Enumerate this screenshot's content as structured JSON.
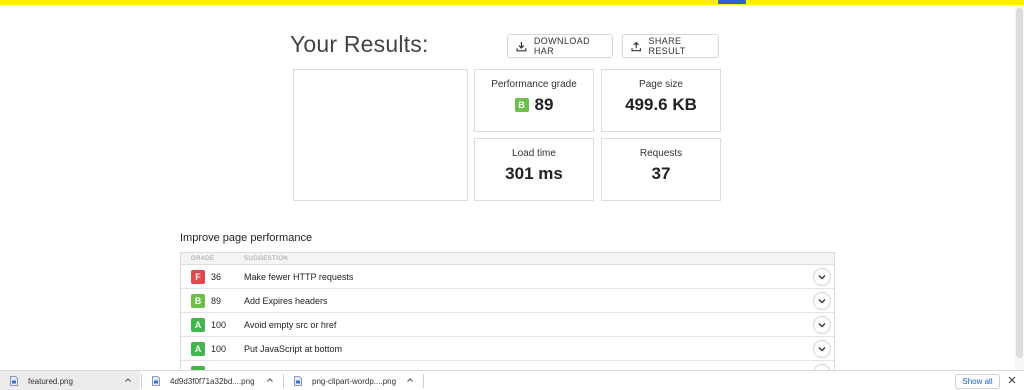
{
  "header": {
    "title": "Your Results:",
    "download_har_label": "DOWNLOAD HAR",
    "share_result_label": "SHARE RESULT"
  },
  "metrics": {
    "performance": {
      "label": "Performance grade",
      "grade": "B",
      "value": "89"
    },
    "page_size": {
      "label": "Page size",
      "value": "499.6 KB"
    },
    "load_time": {
      "label": "Load time",
      "value": "301 ms"
    },
    "requests": {
      "label": "Requests",
      "value": "37"
    }
  },
  "improve": {
    "title": "Improve page performance",
    "columns": {
      "grade": "GRADE",
      "suggestion": "SUGGESTION"
    },
    "rows": [
      {
        "grade": "F",
        "score": "36",
        "suggestion": "Make fewer HTTP requests"
      },
      {
        "grade": "B",
        "score": "89",
        "suggestion": "Add Expires headers"
      },
      {
        "grade": "A",
        "score": "100",
        "suggestion": "Avoid empty src or href"
      },
      {
        "grade": "A",
        "score": "100",
        "suggestion": "Put JavaScript at bottom"
      }
    ]
  },
  "downloads": {
    "items": [
      {
        "name": "featured.png"
      },
      {
        "name": "4d9d3f0f71a32bd....png"
      },
      {
        "name": "png-clipart-wordp....png"
      }
    ],
    "show_all_label": "Show all"
  },
  "colors": {
    "top_bar": "#ffee00",
    "grade_a": "#43b649",
    "grade_b": "#6cc04a",
    "grade_f": "#e5454c",
    "link_blue": "#1a5fd6"
  },
  "icons": [
    "download-icon",
    "share-icon",
    "chevron-down-icon",
    "file-icon",
    "caret-up-icon",
    "close-icon"
  ]
}
